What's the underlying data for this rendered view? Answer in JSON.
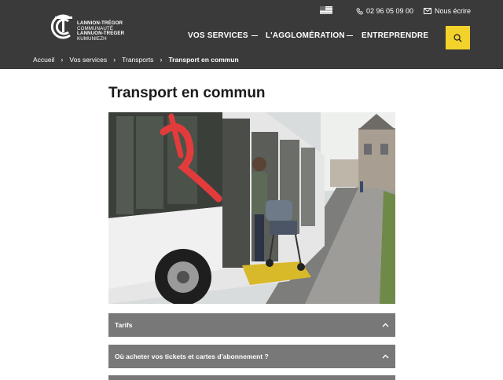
{
  "header": {
    "logo_lines": [
      "LANNION-TRÉGOR",
      "COMMUNAUTÉ",
      "LANNUON-TREGER",
      "KUMUNIEZH"
    ],
    "phone": "02 96 05 09 00",
    "contact": "Nous écrire",
    "nav": [
      "VOS SERVICES",
      "L'AGGLOMÉRATION",
      "ENTREPRENDRE"
    ],
    "colors": {
      "background": "#3a3a3a",
      "accent": "#f3d22c"
    }
  },
  "breadcrumb": {
    "items": [
      "Accueil",
      "Vos services",
      "Transports"
    ],
    "current": "Transport en commun"
  },
  "page": {
    "title": "Transport en commun"
  },
  "accordion": {
    "items": [
      "Tarifs",
      "Où acheter vos tickets et cartes d'abonnement ?"
    ]
  }
}
